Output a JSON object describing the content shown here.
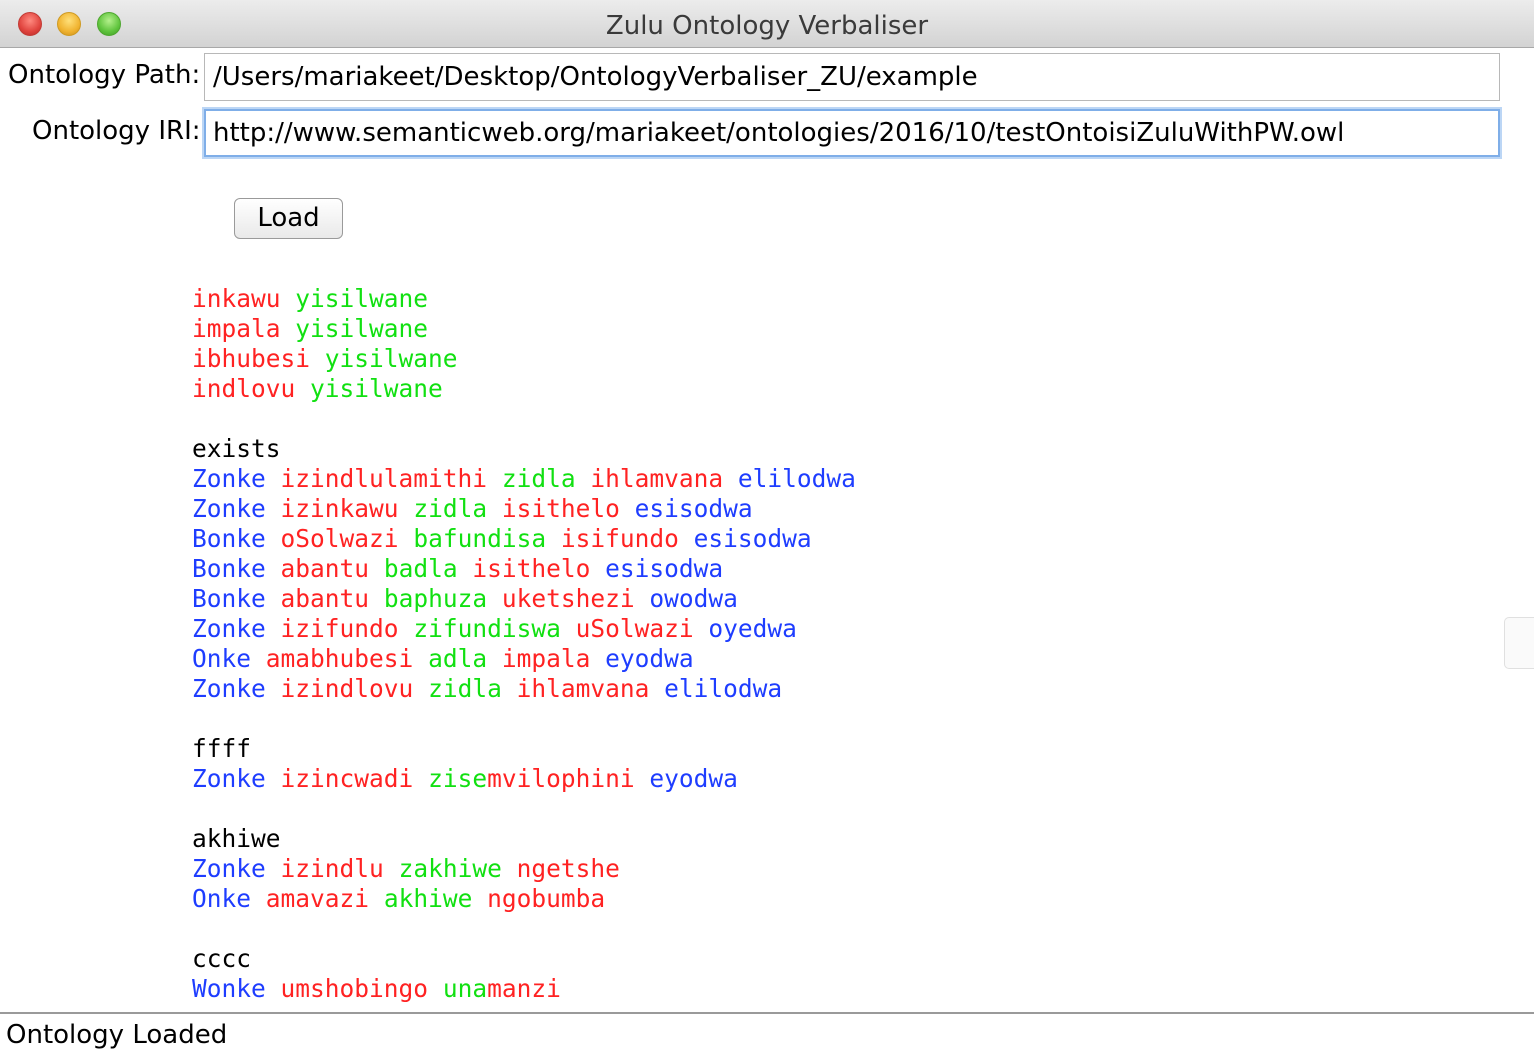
{
  "window": {
    "title": "Zulu Ontology Verbaliser"
  },
  "form": {
    "path_label": "Ontology Path:",
    "path_value": "/Users/mariakeet/Desktop/OntologyVerbaliser_ZU/example",
    "iri_label": "Ontology IRI:",
    "iri_value": "http://www.semanticweb.org/mariakeet/ontologies/2016/10/testOntoisiZuluWithPW.owl",
    "load_label": "Load"
  },
  "colors": {
    "noun": "#ff2222",
    "verb": "#11e011",
    "quantifier": "#1e3dff",
    "heading": "#000000"
  },
  "output_lines": [
    [
      {
        "t": "inkawu",
        "c": "r"
      },
      {
        "t": " ",
        "c": "k"
      },
      {
        "t": "yisilwane",
        "c": "g"
      }
    ],
    [
      {
        "t": "impala",
        "c": "r"
      },
      {
        "t": " ",
        "c": "k"
      },
      {
        "t": "yisilwane",
        "c": "g"
      }
    ],
    [
      {
        "t": "ibhubesi",
        "c": "r"
      },
      {
        "t": " ",
        "c": "k"
      },
      {
        "t": "yisilwane",
        "c": "g"
      }
    ],
    [
      {
        "t": "indlovu",
        "c": "r"
      },
      {
        "t": " ",
        "c": "k"
      },
      {
        "t": "yisilwane",
        "c": "g"
      }
    ],
    [],
    [
      {
        "t": "exists",
        "c": "k"
      }
    ],
    [
      {
        "t": "Zonke",
        "c": "b"
      },
      {
        "t": " ",
        "c": "k"
      },
      {
        "t": "izindlulamithi",
        "c": "r"
      },
      {
        "t": " ",
        "c": "k"
      },
      {
        "t": "zidla",
        "c": "g"
      },
      {
        "t": " ",
        "c": "k"
      },
      {
        "t": "ihlamvana",
        "c": "r"
      },
      {
        "t": " ",
        "c": "k"
      },
      {
        "t": "elilodwa",
        "c": "b"
      }
    ],
    [
      {
        "t": "Zonke",
        "c": "b"
      },
      {
        "t": " ",
        "c": "k"
      },
      {
        "t": "izinkawu",
        "c": "r"
      },
      {
        "t": " ",
        "c": "k"
      },
      {
        "t": "zidla",
        "c": "g"
      },
      {
        "t": " ",
        "c": "k"
      },
      {
        "t": "isithelo",
        "c": "r"
      },
      {
        "t": " ",
        "c": "k"
      },
      {
        "t": "esisodwa",
        "c": "b"
      }
    ],
    [
      {
        "t": "Bonke",
        "c": "b"
      },
      {
        "t": " ",
        "c": "k"
      },
      {
        "t": "oSolwazi",
        "c": "r"
      },
      {
        "t": " ",
        "c": "k"
      },
      {
        "t": "bafundisa",
        "c": "g"
      },
      {
        "t": " ",
        "c": "k"
      },
      {
        "t": "isifundo",
        "c": "r"
      },
      {
        "t": " ",
        "c": "k"
      },
      {
        "t": "esisodwa",
        "c": "b"
      }
    ],
    [
      {
        "t": "Bonke",
        "c": "b"
      },
      {
        "t": " ",
        "c": "k"
      },
      {
        "t": "abantu",
        "c": "r"
      },
      {
        "t": " ",
        "c": "k"
      },
      {
        "t": "badla",
        "c": "g"
      },
      {
        "t": " ",
        "c": "k"
      },
      {
        "t": "isithelo",
        "c": "r"
      },
      {
        "t": " ",
        "c": "k"
      },
      {
        "t": "esisodwa",
        "c": "b"
      }
    ],
    [
      {
        "t": "Bonke",
        "c": "b"
      },
      {
        "t": " ",
        "c": "k"
      },
      {
        "t": "abantu",
        "c": "r"
      },
      {
        "t": " ",
        "c": "k"
      },
      {
        "t": "baphuza",
        "c": "g"
      },
      {
        "t": " ",
        "c": "k"
      },
      {
        "t": "uketshezi",
        "c": "r"
      },
      {
        "t": " ",
        "c": "k"
      },
      {
        "t": "owodwa",
        "c": "b"
      }
    ],
    [
      {
        "t": "Zonke",
        "c": "b"
      },
      {
        "t": " ",
        "c": "k"
      },
      {
        "t": "izifundo",
        "c": "r"
      },
      {
        "t": " ",
        "c": "k"
      },
      {
        "t": "zifundiswa",
        "c": "g"
      },
      {
        "t": " ",
        "c": "k"
      },
      {
        "t": "uSolwazi",
        "c": "r"
      },
      {
        "t": " ",
        "c": "k"
      },
      {
        "t": "oyedwa",
        "c": "b"
      }
    ],
    [
      {
        "t": "Onke",
        "c": "b"
      },
      {
        "t": " ",
        "c": "k"
      },
      {
        "t": "amabhubesi",
        "c": "r"
      },
      {
        "t": " ",
        "c": "k"
      },
      {
        "t": "adla",
        "c": "g"
      },
      {
        "t": " ",
        "c": "k"
      },
      {
        "t": "impala",
        "c": "r"
      },
      {
        "t": " ",
        "c": "k"
      },
      {
        "t": "eyodwa",
        "c": "b"
      }
    ],
    [
      {
        "t": "Zonke",
        "c": "b"
      },
      {
        "t": " ",
        "c": "k"
      },
      {
        "t": "izindlovu",
        "c": "r"
      },
      {
        "t": " ",
        "c": "k"
      },
      {
        "t": "zidla",
        "c": "g"
      },
      {
        "t": " ",
        "c": "k"
      },
      {
        "t": "ihlamvana",
        "c": "r"
      },
      {
        "t": " ",
        "c": "k"
      },
      {
        "t": "elilodwa",
        "c": "b"
      }
    ],
    [],
    [
      {
        "t": "ffff",
        "c": "k"
      }
    ],
    [
      {
        "t": "Zonke",
        "c": "b"
      },
      {
        "t": " ",
        "c": "k"
      },
      {
        "t": "izincwadi",
        "c": "r"
      },
      {
        "t": " ",
        "c": "k"
      },
      {
        "t": "zise",
        "c": "g"
      },
      {
        "t": "mvilophini",
        "c": "r"
      },
      {
        "t": " ",
        "c": "k"
      },
      {
        "t": "eyodwa",
        "c": "b"
      }
    ],
    [],
    [
      {
        "t": "akhiwe",
        "c": "k"
      }
    ],
    [
      {
        "t": "Zonke",
        "c": "b"
      },
      {
        "t": " ",
        "c": "k"
      },
      {
        "t": "izindlu",
        "c": "r"
      },
      {
        "t": " ",
        "c": "k"
      },
      {
        "t": "zakhiwe",
        "c": "g"
      },
      {
        "t": " ",
        "c": "k"
      },
      {
        "t": "ngetshe",
        "c": "r"
      }
    ],
    [
      {
        "t": "Onke",
        "c": "b"
      },
      {
        "t": " ",
        "c": "k"
      },
      {
        "t": "amavazi",
        "c": "r"
      },
      {
        "t": " ",
        "c": "k"
      },
      {
        "t": "akhiwe",
        "c": "g"
      },
      {
        "t": " ",
        "c": "k"
      },
      {
        "t": "ngobumba",
        "c": "r"
      }
    ],
    [],
    [
      {
        "t": "cccc",
        "c": "k"
      }
    ],
    [
      {
        "t": "Wonke",
        "c": "b"
      },
      {
        "t": " ",
        "c": "k"
      },
      {
        "t": "umshobingo",
        "c": "r"
      },
      {
        "t": " ",
        "c": "k"
      },
      {
        "t": "una",
        "c": "g"
      },
      {
        "t": "manzi",
        "c": "r"
      }
    ]
  ],
  "status": {
    "text": "Ontology Loaded"
  }
}
